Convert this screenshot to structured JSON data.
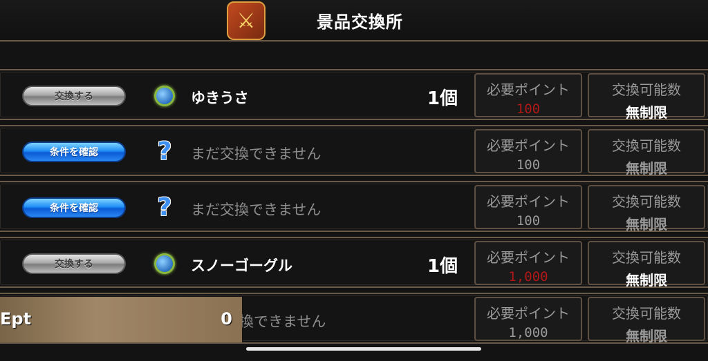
{
  "header": {
    "title": "景品交換所",
    "icon": "shop-icon"
  },
  "labels": {
    "points": "必要ポイント",
    "limit": "交換可能数"
  },
  "rows": [
    {
      "button": "交換する",
      "button_style": "gray",
      "icon": "hat-icon",
      "name": "ゆきうさ",
      "qty": "1個",
      "points": "100",
      "points_color": "#b01818",
      "limit": "無制限"
    },
    {
      "button": "条件を確認",
      "button_style": "blue",
      "icon": "question-icon",
      "name": "まだ交換できません",
      "qty": "",
      "points": "100",
      "points_color": "#9a9a9a",
      "limit": "無制限"
    },
    {
      "button": "条件を確認",
      "button_style": "blue",
      "icon": "question-icon",
      "name": "まだ交換できません",
      "qty": "",
      "points": "100",
      "points_color": "#9a9a9a",
      "limit": "無制限"
    },
    {
      "button": "交換する",
      "button_style": "gray",
      "icon": "hat-icon",
      "name": "スノーゴーグル",
      "qty": "1個",
      "points": "1,000",
      "points_color": "#b01818",
      "limit": "無制限"
    },
    {
      "button": "",
      "button_style": "",
      "icon": "",
      "name": "換できません",
      "qty": "",
      "points": "1,000",
      "points_color": "#9a9a9a",
      "limit": "無制限"
    }
  ],
  "points_overlay": {
    "label": "Ept",
    "value": "0"
  }
}
